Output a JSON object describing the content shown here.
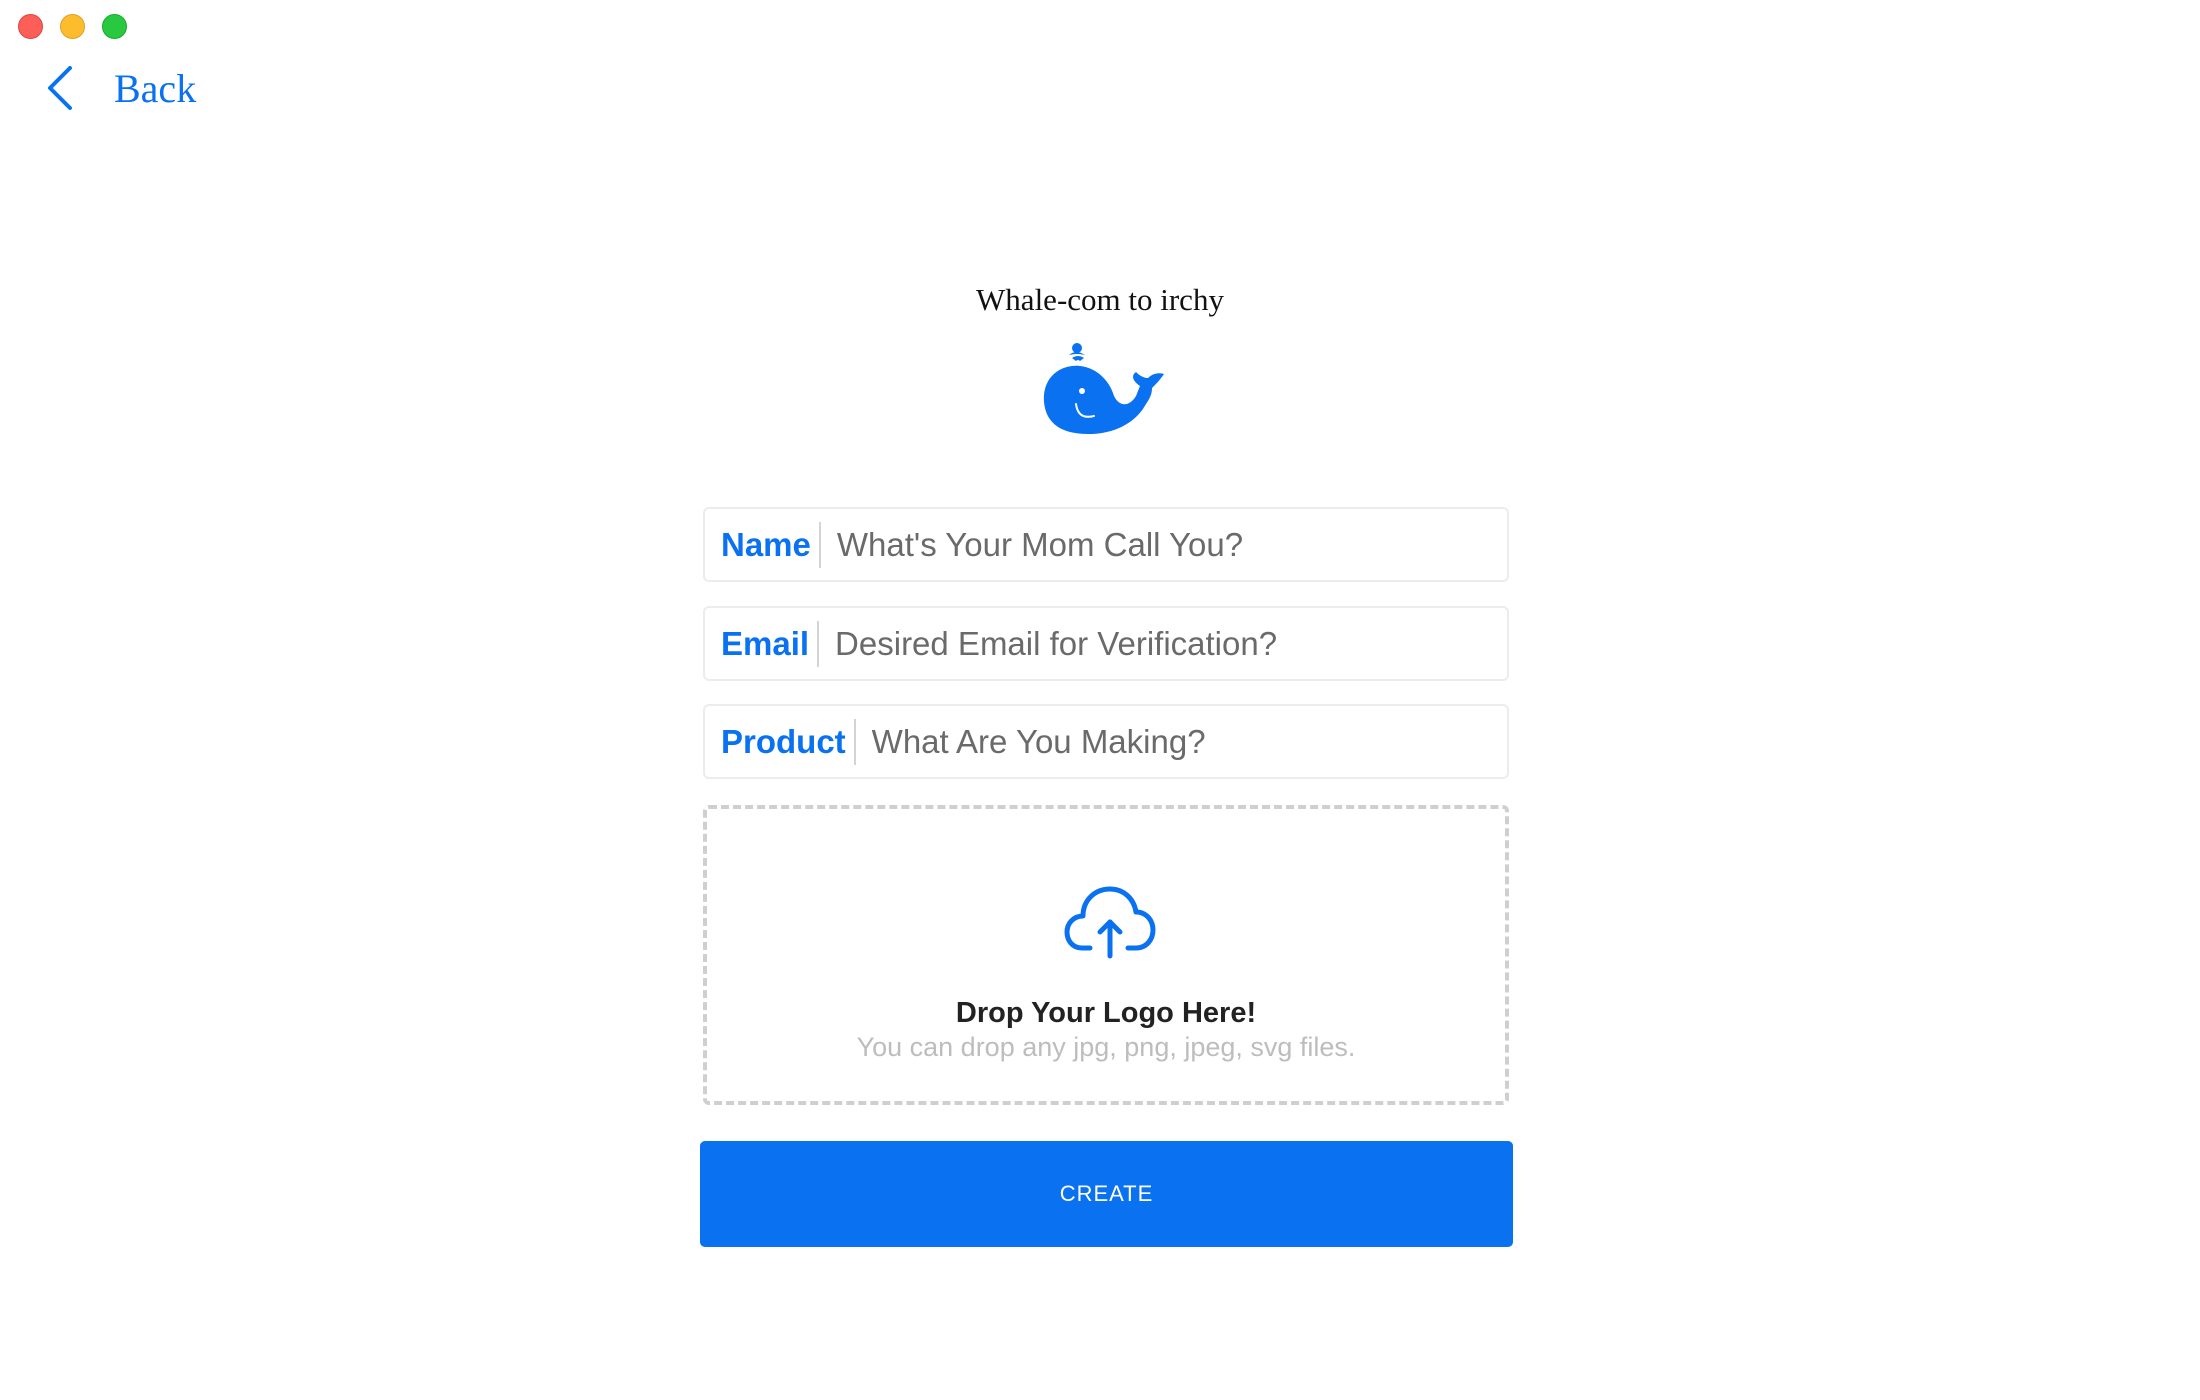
{
  "window": {
    "controls": [
      "close",
      "minimize",
      "maximize"
    ]
  },
  "nav": {
    "back_label": "Back",
    "back_icon": "chevron-left-icon"
  },
  "header": {
    "welcome": "Whale-com to irchy",
    "logo_icon": "whale-icon"
  },
  "form": {
    "name": {
      "label": "Name",
      "placeholder": "What's Your Mom Call You?"
    },
    "email": {
      "label": "Email",
      "placeholder": "Desired Email for Verification?"
    },
    "product": {
      "label": "Product",
      "placeholder": "What Are You Making?"
    }
  },
  "dropzone": {
    "icon": "cloud-upload-icon",
    "title": "Drop Your Logo Here!",
    "subtitle": "You can drop any jpg, png, jpeg, svg files."
  },
  "submit": {
    "label": "CREATE"
  },
  "colors": {
    "accent": "#0a72f1",
    "close": "#fc5f57",
    "minimize": "#fdbc2e",
    "maximize": "#28c840"
  }
}
